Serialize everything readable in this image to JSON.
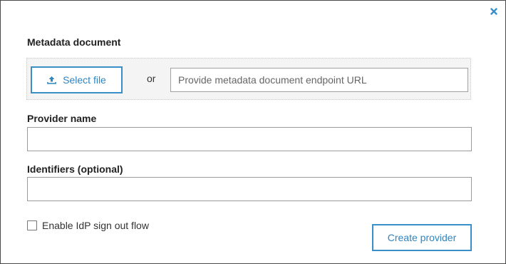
{
  "dialog": {
    "close_icon": "close-icon",
    "metadata": {
      "label": "Metadata document",
      "select_file_label": "Select file",
      "upload_icon": "upload-icon",
      "or_text": "or",
      "url_placeholder": "Provide metadata document endpoint URL",
      "url_value": ""
    },
    "provider_name": {
      "label": "Provider name",
      "value": ""
    },
    "identifiers": {
      "label": "Identifiers (optional)",
      "value": ""
    },
    "signout": {
      "label": "Enable IdP sign out flow",
      "checked": false
    },
    "create_button_label": "Create provider"
  },
  "colors": {
    "accent": "#3b8fc8",
    "accent_text": "#2f85c0",
    "border": "#9a9a9a",
    "dropzone_bg": "#f4f4f4"
  }
}
